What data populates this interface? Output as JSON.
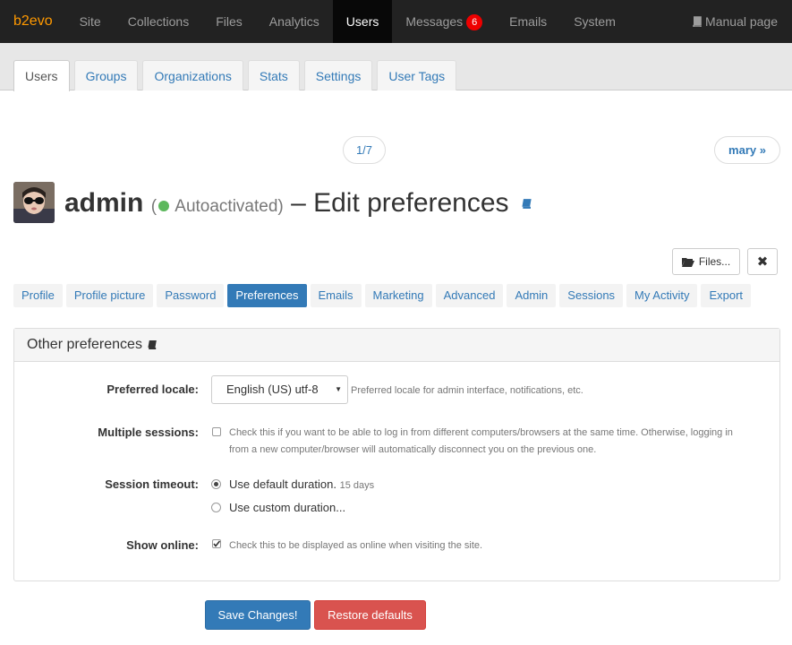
{
  "topnav": {
    "brand": "b2evo",
    "items": [
      {
        "label": "Site"
      },
      {
        "label": "Collections"
      },
      {
        "label": "Files"
      },
      {
        "label": "Analytics"
      },
      {
        "label": "Users",
        "active": true
      },
      {
        "label": "Messages",
        "badge": "6"
      },
      {
        "label": "Emails"
      },
      {
        "label": "System"
      }
    ],
    "manual": "Manual page"
  },
  "subtabs": [
    "Users",
    "Groups",
    "Organizations",
    "Stats",
    "Settings",
    "User Tags"
  ],
  "pager": {
    "page": "1/7",
    "next": "mary »"
  },
  "title": {
    "user": "admin",
    "status_open": "(",
    "status": "Autoactivated)",
    "rest": "– Edit preferences"
  },
  "buttons": {
    "files": "Files...",
    "close": "✖"
  },
  "sectabs": [
    "Profile",
    "Profile picture",
    "Password",
    "Preferences",
    "Emails",
    "Marketing",
    "Advanced",
    "Admin",
    "Sessions",
    "My Activity",
    "Export"
  ],
  "panel": {
    "title": "Other preferences",
    "locale": {
      "label": "Preferred locale:",
      "value": "English (US) utf-8",
      "note": "Preferred locale for admin interface, notifications, etc."
    },
    "sessions": {
      "label": "Multiple sessions:",
      "note1": "Check this if you want to be able to log in from different computers/browsers at the same time. Otherwise, logging in",
      "note2": "from a new computer/browser will automatically disconnect you on the previous one."
    },
    "timeout": {
      "label": "Session timeout:",
      "opt1": "Use default duration.",
      "opt1_note": "15 days",
      "opt2": "Use custom duration..."
    },
    "online": {
      "label": "Show online:",
      "note": "Check this to be displayed as online when visiting the site."
    }
  },
  "actions": {
    "save": "Save Changes!",
    "restore": "Restore defaults"
  },
  "colors": {
    "brand": "#ff9900",
    "primary": "#337ab7",
    "danger": "#d9534f",
    "status": "#5cb85c"
  }
}
